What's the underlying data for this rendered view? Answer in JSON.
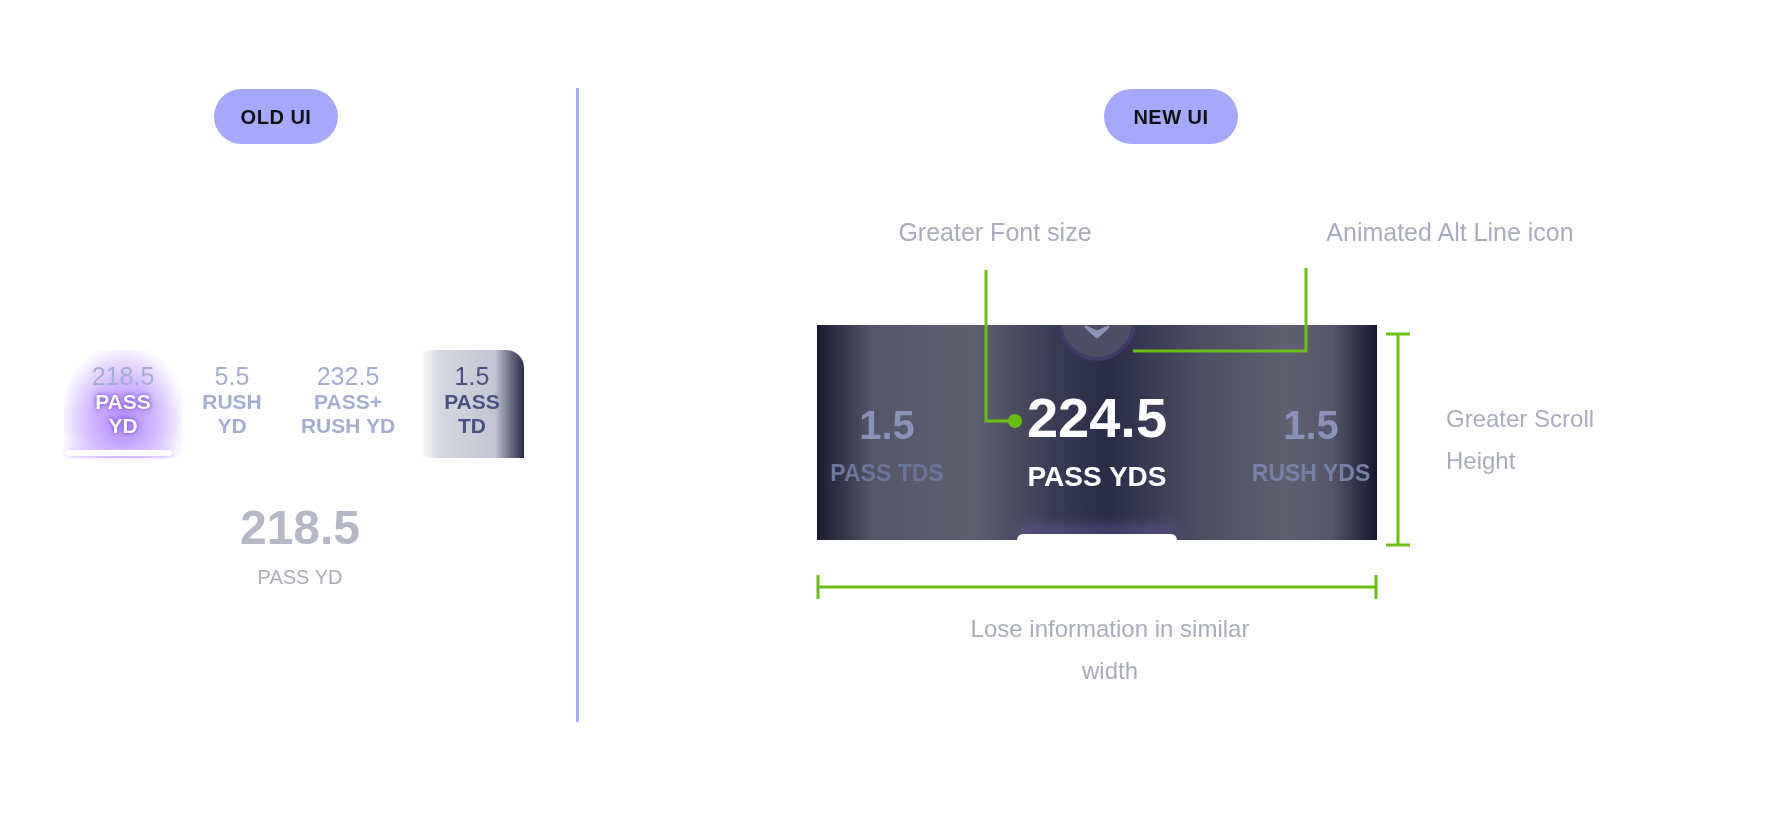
{
  "old_ui": {
    "badge": "OLD UI",
    "tabs": [
      {
        "value": "218.5",
        "label": "PASS YD",
        "selected": true
      },
      {
        "value": "5.5",
        "label": "RUSH YD",
        "selected": false
      },
      {
        "value": "232.5",
        "label": "PASS+ RUSH YD",
        "selected": false
      },
      {
        "value": "1.5",
        "label": "PASS TD",
        "selected": false
      }
    ],
    "detail": {
      "value": "218.5",
      "label": "PASS YD"
    }
  },
  "new_ui": {
    "badge": "NEW UI",
    "card": {
      "left": {
        "value": "1.5",
        "label": "PASS TDS"
      },
      "center": {
        "value": "224.5",
        "label": "PASS YDS"
      },
      "right": {
        "value": "1.5",
        "label": "RUSH YDS"
      }
    },
    "annotations": {
      "font": "Greater Font size",
      "icon": "Animated Alt Line icon",
      "height": "Greater Scroll Height",
      "width": "Lose information in similar width"
    }
  }
}
